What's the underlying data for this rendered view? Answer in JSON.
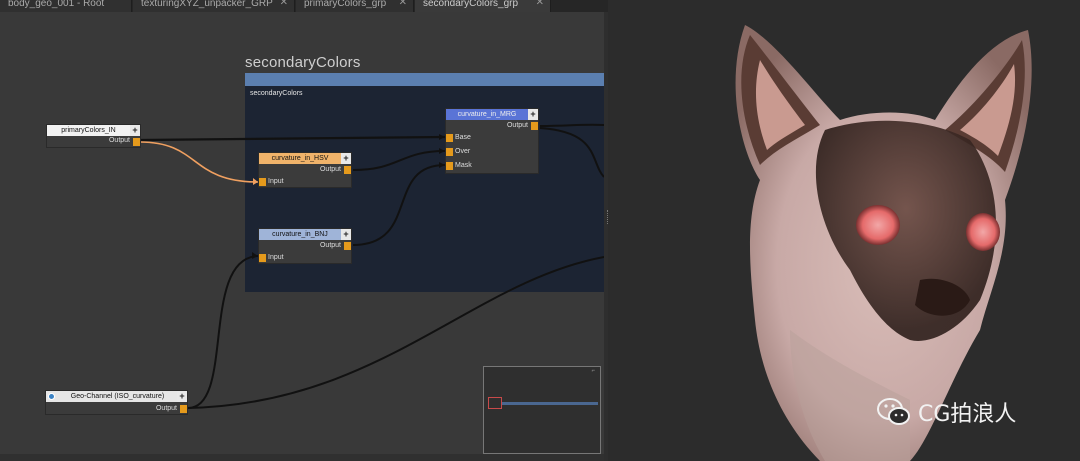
{
  "tabs": [
    {
      "label": "body_geo_001 - Root",
      "active": false,
      "closable": false
    },
    {
      "label": "texturingXYZ_unpacker_GRP",
      "active": false,
      "closable": true
    },
    {
      "label": "primaryColors_grp",
      "active": false,
      "closable": true
    },
    {
      "label": "secondaryColors_grp",
      "active": true,
      "closable": true
    }
  ],
  "close_glyph": "✕",
  "backdrop": {
    "title": "secondaryColors",
    "label": "secondaryColors",
    "bar_color": "#5b7fb0",
    "bg_color": "#1c2433"
  },
  "nodes": {
    "primary_in": {
      "name": "primaryColors_IN",
      "output": "Output"
    },
    "hsv": {
      "name": "curvature_in_HSV",
      "input": "Input",
      "output": "Output",
      "color": "#f0b36a"
    },
    "bnj": {
      "name": "curvature_in_BNJ",
      "input": "Input",
      "output": "Output",
      "color": "#9fb4d8"
    },
    "mrg": {
      "name": "curvature_in_MRG",
      "inputs": [
        "Base",
        "Over",
        "Mask"
      ],
      "output": "Output",
      "color": "#5a74d6"
    },
    "geo_channel": {
      "name": "Geo-Channel (ISO_curvature)",
      "output": "Output"
    }
  },
  "plus_glyph": "+",
  "minimap": {
    "corner_glyph": "⌐"
  },
  "viewport": {
    "subject": "cat-head-3d-model"
  },
  "watermark": {
    "text": "CG拍浪人",
    "icon": "wechat-icon"
  },
  "colors": {
    "port": "#e59a1c",
    "wire_highlight": "#f0a060",
    "wire": "#111111"
  }
}
